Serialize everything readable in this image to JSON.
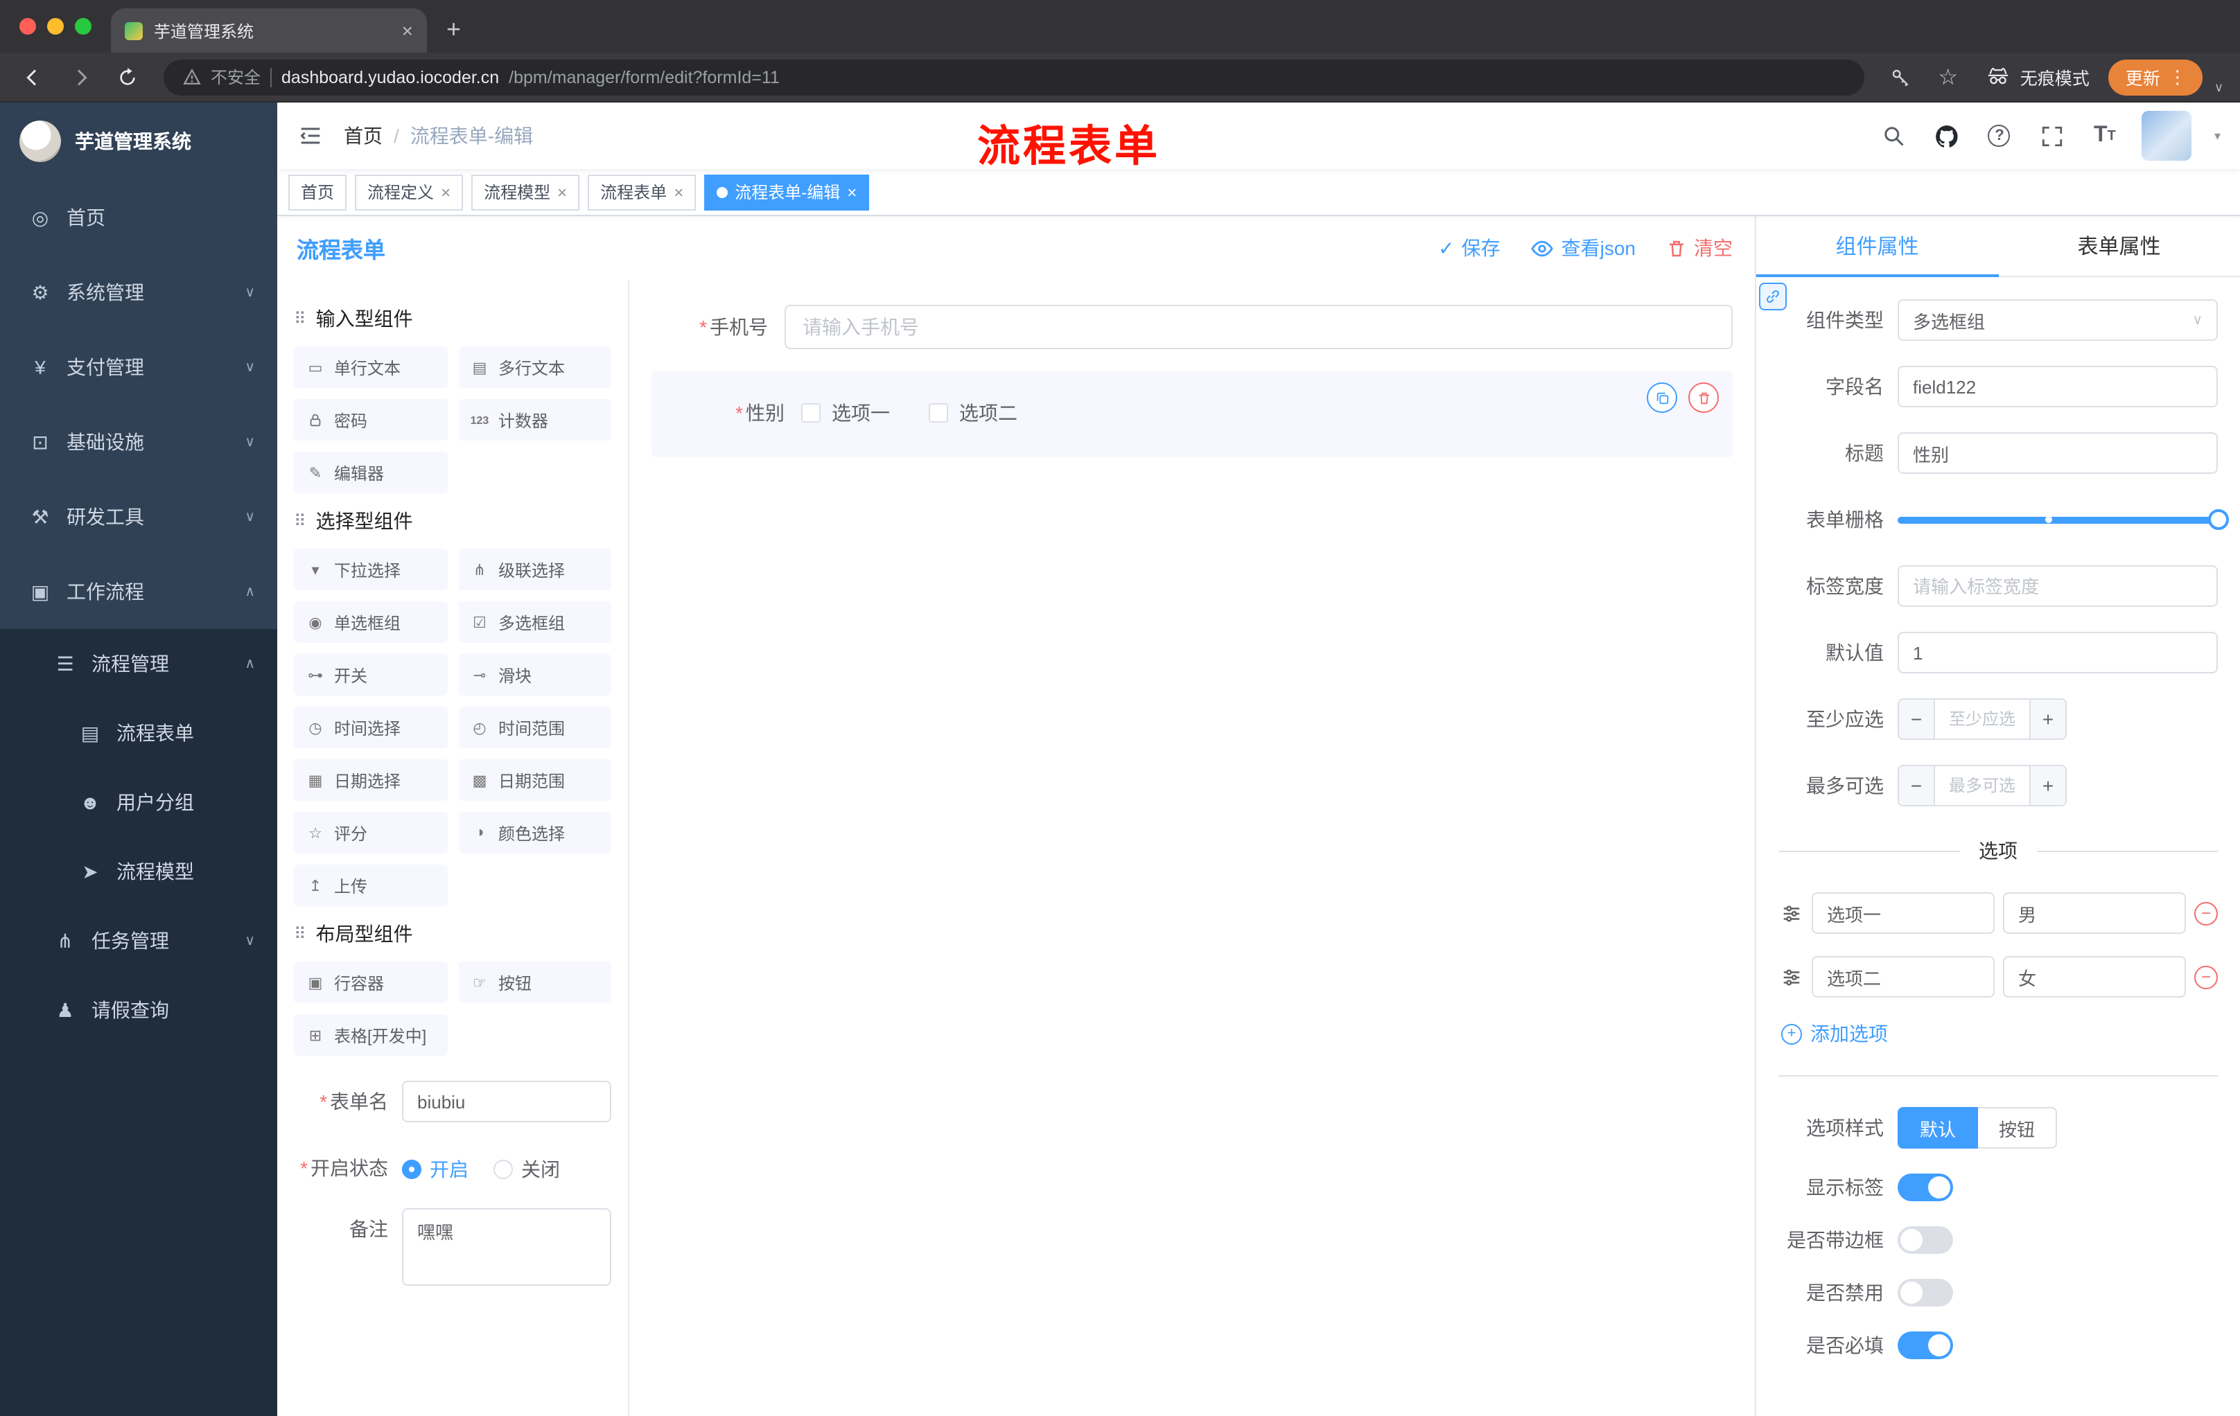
{
  "browser": {
    "tab_title": "芋道管理系统",
    "security_label": "不安全",
    "url_host": "dashboard.yudao.iocoder.cn",
    "url_path": "/bpm/manager/form/edit?formId=11",
    "incognito_label": "无痕模式",
    "update_label": "更新"
  },
  "sidebar": {
    "logo_title": "芋道管理系统",
    "items": [
      {
        "label": "首页",
        "icon": "dashboard-icon"
      },
      {
        "label": "系统管理",
        "icon": "gear-icon"
      },
      {
        "label": "支付管理",
        "icon": "yen-icon"
      },
      {
        "label": "基础设施",
        "icon": "monitor-icon"
      },
      {
        "label": "研发工具",
        "icon": "tools-icon"
      },
      {
        "label": "工作流程",
        "icon": "workflow-icon"
      },
      {
        "label": "流程管理",
        "icon": "list-icon"
      },
      {
        "label": "流程表单",
        "icon": "form-icon"
      },
      {
        "label": "用户分组",
        "icon": "user-group-icon"
      },
      {
        "label": "流程模型",
        "icon": "paper-plane-icon"
      },
      {
        "label": "任务管理",
        "icon": "tree-icon"
      },
      {
        "label": "请假查询",
        "icon": "user-icon"
      }
    ]
  },
  "header": {
    "breadcrumb_home": "首页",
    "breadcrumb_current": "流程表单-编辑",
    "annotation": "流程表单"
  },
  "tags": [
    {
      "label": "首页"
    },
    {
      "label": "流程定义"
    },
    {
      "label": "流程模型"
    },
    {
      "label": "流程表单"
    },
    {
      "label": "流程表单-编辑"
    }
  ],
  "designer": {
    "title": "流程表单",
    "actions": {
      "save": "保存",
      "view_json": "查看json",
      "clear": "清空"
    },
    "groups": [
      {
        "title": "输入型组件",
        "items": [
          {
            "label": "单行文本",
            "icon": "input-icon"
          },
          {
            "label": "多行文本",
            "icon": "textarea-icon"
          },
          {
            "label": "密码",
            "icon": "lock-icon"
          },
          {
            "label": "计数器",
            "icon": "counter-icon"
          },
          {
            "label": "编辑器",
            "icon": "editor-icon"
          }
        ]
      },
      {
        "title": "选择型组件",
        "items": [
          {
            "label": "下拉选择",
            "icon": "select-icon"
          },
          {
            "label": "级联选择",
            "icon": "cascader-icon"
          },
          {
            "label": "单选框组",
            "icon": "radio-group-icon"
          },
          {
            "label": "多选框组",
            "icon": "checkbox-group-icon"
          },
          {
            "label": "开关",
            "icon": "switch-icon"
          },
          {
            "label": "滑块",
            "icon": "slider-icon"
          },
          {
            "label": "时间选择",
            "icon": "time-icon"
          },
          {
            "label": "时间范围",
            "icon": "time-range-icon"
          },
          {
            "label": "日期选择",
            "icon": "date-icon"
          },
          {
            "label": "日期范围",
            "icon": "date-range-icon"
          },
          {
            "label": "评分",
            "icon": "rate-icon"
          },
          {
            "label": "颜色选择",
            "icon": "color-icon"
          },
          {
            "label": "上传",
            "icon": "upload-icon"
          }
        ]
      },
      {
        "title": "布局型组件",
        "items": [
          {
            "label": "行容器",
            "icon": "row-icon"
          },
          {
            "label": "按钮",
            "icon": "button-icon"
          },
          {
            "label": "表格[开发中]",
            "icon": "table-icon"
          }
        ]
      }
    ],
    "meta": {
      "form_name_label": "表单名",
      "form_name_value": "biubiu",
      "status_label": "开启状态",
      "status_on": "开启",
      "status_off": "关闭",
      "remark_label": "备注",
      "remark_value": "嘿嘿"
    },
    "canvas": {
      "phone_label": "手机号",
      "phone_placeholder": "请输入手机号",
      "gender_label": "性别",
      "gender_opt1": "选项一",
      "gender_opt2": "选项二"
    }
  },
  "props": {
    "tab_component": "组件属性",
    "tab_form": "表单属性",
    "component_type_label": "组件类型",
    "component_type_value": "多选框组",
    "field_name_label": "字段名",
    "field_name_value": "field122",
    "title_label": "标题",
    "title_value": "性别",
    "grid_label": "表单栅格",
    "label_width_label": "标签宽度",
    "label_width_placeholder": "请输入标签宽度",
    "default_label": "默认值",
    "default_value": "1",
    "min_label": "至少应选",
    "min_placeholder": "至少应选",
    "max_label": "最多可选",
    "max_placeholder": "最多可选",
    "options_title": "选项",
    "options": [
      {
        "label": "选项一",
        "value": "男"
      },
      {
        "label": "选项二",
        "value": "女"
      }
    ],
    "add_option": "添加选项",
    "option_style_label": "选项样式",
    "style_default": "默认",
    "style_button": "按钮",
    "toggles": [
      {
        "label": "显示标签",
        "on": true
      },
      {
        "label": "是否带边框",
        "on": false
      },
      {
        "label": "是否禁用",
        "on": false
      },
      {
        "label": "是否必填",
        "on": true
      }
    ]
  },
  "colors": {
    "primary": "#409EFF",
    "danger": "#F56C6C",
    "sidebar_bg": "#304156",
    "submenu_bg": "#1F2D3D",
    "active_tag": "#409EFF",
    "update_pill": "#E8833A",
    "annotation_red": "#FF1200"
  }
}
